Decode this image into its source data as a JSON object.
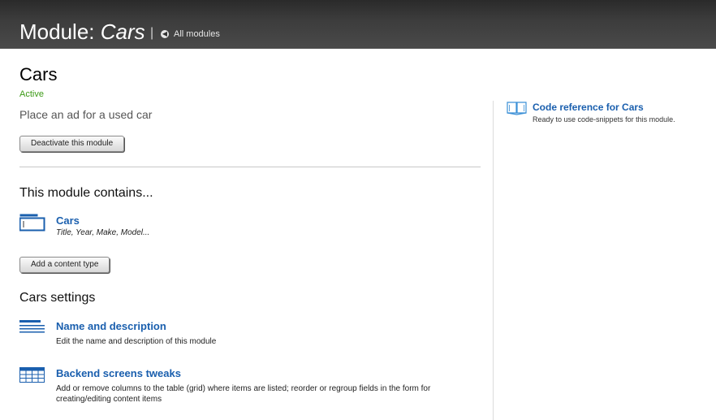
{
  "header": {
    "title_prefix": "Module: ",
    "title_module": "Cars",
    "separator": "|",
    "back_label": "All modules",
    "back_icon": "circle-arrow-left-icon"
  },
  "module": {
    "name": "Cars",
    "status": "Active",
    "status_color": "#3c9a16",
    "description": "Place an ad for a used car",
    "deactivate_label": "Deactivate this module"
  },
  "contains": {
    "title": "This module contains...",
    "items": [
      {
        "name": "Cars",
        "fields": "Title, Year, Make, Model...",
        "icon": "content-type-icon"
      }
    ],
    "add_label": "Add a content type"
  },
  "settings": {
    "title": "Cars settings",
    "items": [
      {
        "name": "Name and description",
        "description": "Edit the name and description of this module",
        "icon": "text-lines-icon"
      },
      {
        "name": "Backend screens tweaks",
        "description": "Add or remove columns to the table (grid) where items are listed; reorder or regroup fields in the form for creating/editing content items",
        "icon": "grid-table-icon"
      }
    ]
  },
  "sidebar": {
    "code_reference": {
      "label": "Code reference for Cars",
      "description": "Ready to use code-snippets for this module.",
      "icon": "open-book-icon"
    }
  },
  "colors": {
    "link": "#1a5fae",
    "header_bg": "#3a3a3a"
  }
}
